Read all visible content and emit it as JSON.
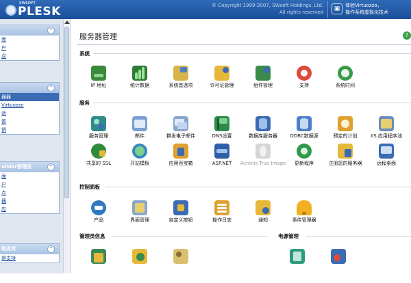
{
  "header": {
    "logo_small": "SWSOFT",
    "logo_main": "PLESK",
    "copyright_line1": "© Copyright 1999-2007, SWsoft Holdings, Ltd.",
    "copyright_line2": "All rights reserved",
    "promo_line1": "体验Virtuozzo，",
    "promo_line2": "操作系统虚拟化技术"
  },
  "sidebar": {
    "sections": [
      {
        "items": [
          "面",
          "户",
          "点"
        ]
      },
      {
        "items": [
          "器器",
          "Virtuozzo",
          "话",
          "置",
          "销"
        ],
        "selected_index": 0
      },
      {
        "title": "uilder管理员",
        "items": [
          "面",
          "户",
          "点",
          "器",
          "应"
        ]
      },
      {
        "title": "助支持",
        "items": [
          "帮支持"
        ]
      }
    ]
  },
  "main": {
    "title": "服务器管理",
    "sections": {
      "system": "系统",
      "services": "服务",
      "control_panel": "控制面板",
      "admin_info": "管理员信息",
      "power_management": "电源管理"
    },
    "system_tools": [
      "IP 地址",
      "统计数据",
      "系统首选项",
      "许可证管理",
      "组件管理",
      "支持",
      "系统时间"
    ],
    "service_tools_row1": [
      "服务管理",
      "邮件",
      "群发电子邮件",
      "DNS设置",
      "数据库服务器",
      "ODBC数据源",
      "预定的计划",
      "IIS 应用程序池"
    ],
    "service_tools_row2": [
      "共享的 SSL",
      "开站模板",
      "应用百宝箱",
      "ASP.NET",
      "Acronis True Image",
      "更新程序",
      "注册您的服务器",
      "远程桌面"
    ],
    "control_tools": [
      "产品",
      "界面管理",
      "自定义按钮",
      "操作日志",
      "通知",
      "事件管理器"
    ]
  },
  "colors": {
    "header_bg": "#1b4f98",
    "sidebar_bg": "#dfe6f0",
    "link": "#1a4a9a",
    "selected": "#3b6bb5"
  }
}
